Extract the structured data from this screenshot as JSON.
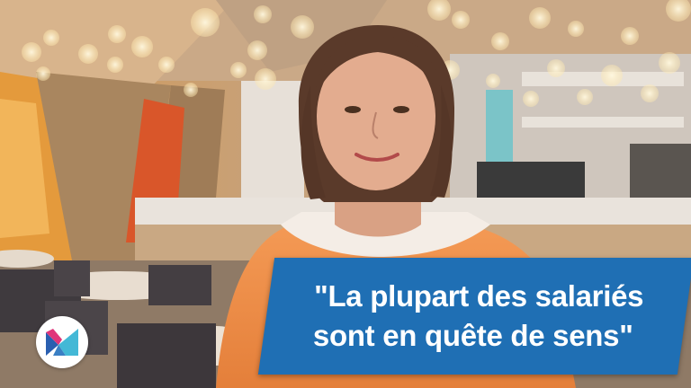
{
  "caption": {
    "line1": "\"La plupart des salariés",
    "line2": "sont en quête de sens\"",
    "background": "#1f6fb4"
  },
  "logo": {
    "icon": "m-logo-icon",
    "colors": [
      "#e0357a",
      "#2a5fb0",
      "#43b8d6"
    ]
  }
}
